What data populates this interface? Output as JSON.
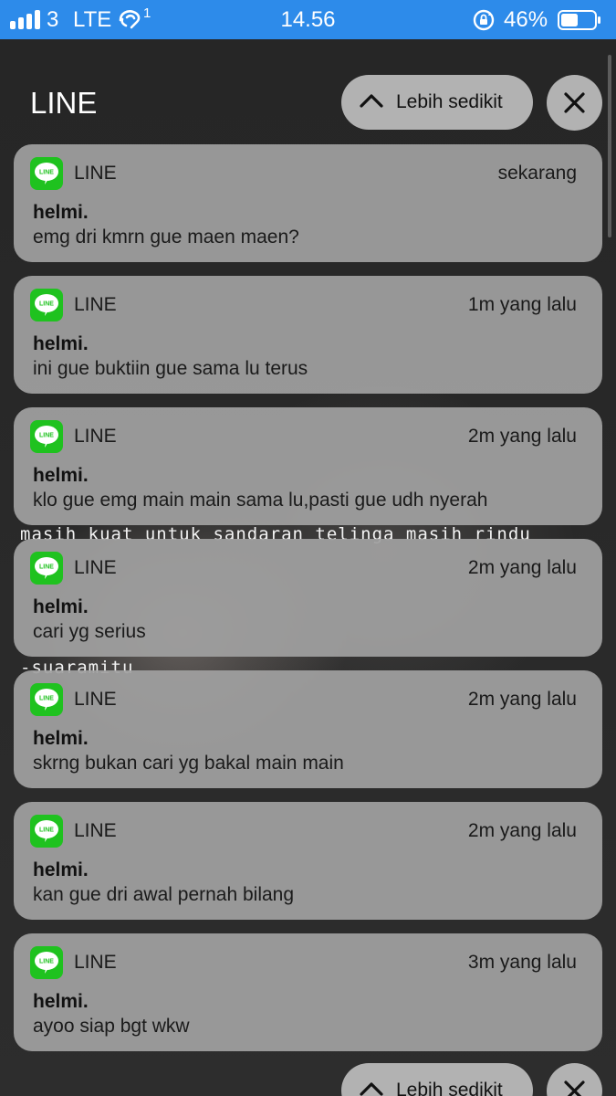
{
  "status_bar": {
    "carrier": "3",
    "network": "LTE",
    "wifi_calling_badge": "1",
    "time": "14.56",
    "battery": "46%",
    "icons": [
      "signal-bars-icon",
      "wifi-calling-icon",
      "rotation-lock-icon",
      "battery-icon"
    ]
  },
  "header": {
    "title": "LINE",
    "show_less_label": "Lebih sedikit",
    "close_icon": "close-icon"
  },
  "background_text": {
    "line1": "masih kuat untuk sandaran telinga masih rindu",
    "line2": "-suaramitu"
  },
  "notifications": [
    {
      "app": "LINE",
      "time": "sekarang",
      "sender": "helmi.",
      "message": "emg dri kmrn gue maen maen?"
    },
    {
      "app": "LINE",
      "time": "1m yang lalu",
      "sender": "helmi.",
      "message": "ini gue buktiin gue sama lu terus"
    },
    {
      "app": "LINE",
      "time": "2m yang lalu",
      "sender": "helmi.",
      "message": "klo gue emg main main sama lu,pasti gue udh nyerah"
    },
    {
      "app": "LINE",
      "time": "2m yang lalu",
      "sender": "helmi.",
      "message": "cari yg serius"
    },
    {
      "app": "LINE",
      "time": "2m yang lalu",
      "sender": "helmi.",
      "message": "skrng bukan cari yg bakal main main"
    },
    {
      "app": "LINE",
      "time": "2m yang lalu",
      "sender": "helmi.",
      "message": "kan gue dri awal pernah bilang"
    },
    {
      "app": "LINE",
      "time": "3m yang lalu",
      "sender": "helmi.",
      "message": "ayoo siap bgt wkw"
    }
  ],
  "footer": {
    "show_less_label": "Lebih sedikit"
  },
  "colors": {
    "status_bar": "#2d8bea",
    "line_green": "#1fc21f",
    "card": "#a0a0a0",
    "pill": "#b2b2b2"
  }
}
